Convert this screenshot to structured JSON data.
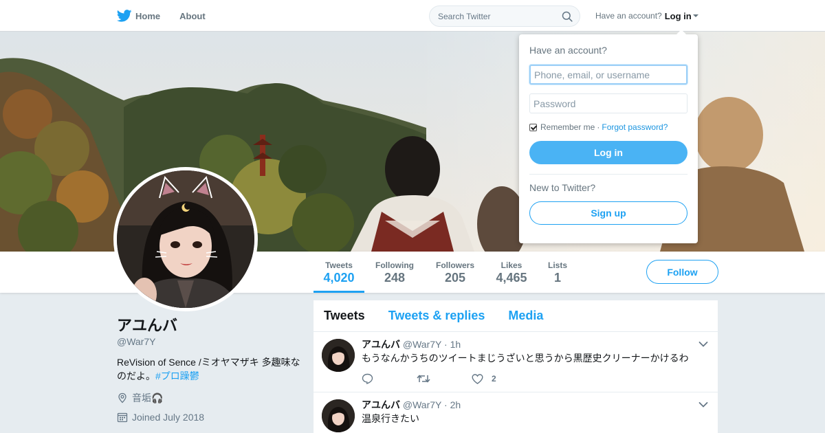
{
  "topnav": {
    "home_label": "Home",
    "about_label": "About",
    "search_placeholder": "Search Twitter",
    "have_account": "Have an account?",
    "login_label": "Log in"
  },
  "profile": {
    "display_name": "アユんバ",
    "handle": "@War7Y",
    "bio_text": "ReVision of Sence /ミオヤマザキ 多趣味なのだよ。",
    "bio_hashtag": "#プロ躁鬱",
    "location": "音垢🎧",
    "joined": "Joined July 2018"
  },
  "stats": [
    {
      "label": "Tweets",
      "value": "4,020"
    },
    {
      "label": "Following",
      "value": "248"
    },
    {
      "label": "Followers",
      "value": "205"
    },
    {
      "label": "Likes",
      "value": "4,465"
    },
    {
      "label": "Lists",
      "value": "1"
    }
  ],
  "follow_label": "Follow",
  "timeline": {
    "tabs": [
      "Tweets",
      "Tweets & replies",
      "Media"
    ],
    "tweets": [
      {
        "name": "アユんバ",
        "handle": "@War7Y",
        "time": "· 1h",
        "text": "もうなんかうちのツイートまじうざいと思うから黒歴史クリーナーかけるわ",
        "likes": "2"
      },
      {
        "name": "アユんバ",
        "handle": "@War7Y",
        "time": "· 2h",
        "text": "温泉行きたい"
      }
    ]
  },
  "login_dropdown": {
    "title": "Have an account?",
    "username_placeholder": "Phone, email, or username",
    "password_placeholder": "Password",
    "remember_label": "Remember me",
    "forgot_label": "Forgot password?",
    "login_button": "Log in",
    "new_to_twitter": "New to Twitter?",
    "signup_button": "Sign up"
  },
  "icons": [
    "twitter-bird-icon",
    "search-icon",
    "caret-down-icon",
    "location-icon",
    "calendar-icon",
    "chevron-down-icon",
    "reply-icon",
    "retweet-icon",
    "like-icon"
  ],
  "colors": {
    "accent": "#1da1f2",
    "login_button": "#4ab3f4",
    "background": "#e6ecf0"
  }
}
